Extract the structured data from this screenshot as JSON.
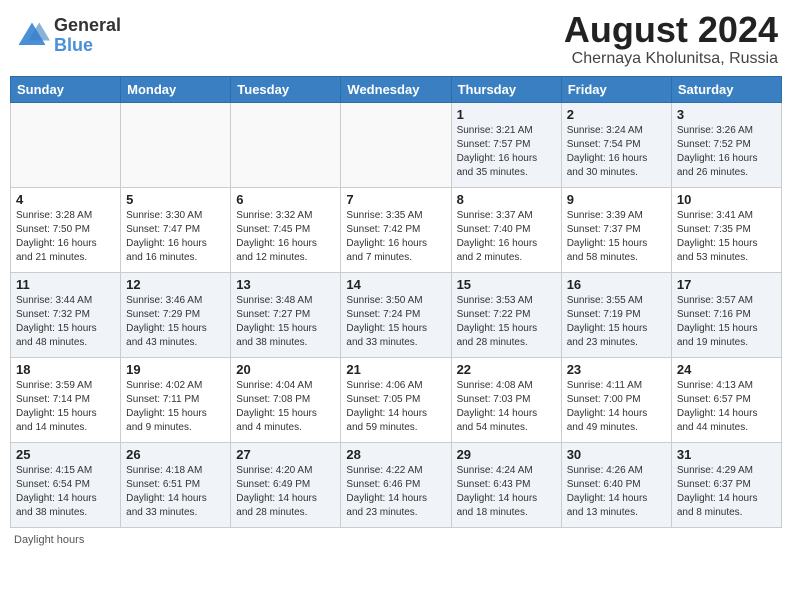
{
  "header": {
    "logo_general": "General",
    "logo_blue": "Blue",
    "month_year": "August 2024",
    "location": "Chernaya Kholunitsa, Russia"
  },
  "days_of_week": [
    "Sunday",
    "Monday",
    "Tuesday",
    "Wednesday",
    "Thursday",
    "Friday",
    "Saturday"
  ],
  "weeks": [
    [
      {
        "day": "",
        "info": ""
      },
      {
        "day": "",
        "info": ""
      },
      {
        "day": "",
        "info": ""
      },
      {
        "day": "",
        "info": ""
      },
      {
        "day": "1",
        "info": "Sunrise: 3:21 AM\nSunset: 7:57 PM\nDaylight: 16 hours and 35 minutes."
      },
      {
        "day": "2",
        "info": "Sunrise: 3:24 AM\nSunset: 7:54 PM\nDaylight: 16 hours and 30 minutes."
      },
      {
        "day": "3",
        "info": "Sunrise: 3:26 AM\nSunset: 7:52 PM\nDaylight: 16 hours and 26 minutes."
      }
    ],
    [
      {
        "day": "4",
        "info": "Sunrise: 3:28 AM\nSunset: 7:50 PM\nDaylight: 16 hours and 21 minutes."
      },
      {
        "day": "5",
        "info": "Sunrise: 3:30 AM\nSunset: 7:47 PM\nDaylight: 16 hours and 16 minutes."
      },
      {
        "day": "6",
        "info": "Sunrise: 3:32 AM\nSunset: 7:45 PM\nDaylight: 16 hours and 12 minutes."
      },
      {
        "day": "7",
        "info": "Sunrise: 3:35 AM\nSunset: 7:42 PM\nDaylight: 16 hours and 7 minutes."
      },
      {
        "day": "8",
        "info": "Sunrise: 3:37 AM\nSunset: 7:40 PM\nDaylight: 16 hours and 2 minutes."
      },
      {
        "day": "9",
        "info": "Sunrise: 3:39 AM\nSunset: 7:37 PM\nDaylight: 15 hours and 58 minutes."
      },
      {
        "day": "10",
        "info": "Sunrise: 3:41 AM\nSunset: 7:35 PM\nDaylight: 15 hours and 53 minutes."
      }
    ],
    [
      {
        "day": "11",
        "info": "Sunrise: 3:44 AM\nSunset: 7:32 PM\nDaylight: 15 hours and 48 minutes."
      },
      {
        "day": "12",
        "info": "Sunrise: 3:46 AM\nSunset: 7:29 PM\nDaylight: 15 hours and 43 minutes."
      },
      {
        "day": "13",
        "info": "Sunrise: 3:48 AM\nSunset: 7:27 PM\nDaylight: 15 hours and 38 minutes."
      },
      {
        "day": "14",
        "info": "Sunrise: 3:50 AM\nSunset: 7:24 PM\nDaylight: 15 hours and 33 minutes."
      },
      {
        "day": "15",
        "info": "Sunrise: 3:53 AM\nSunset: 7:22 PM\nDaylight: 15 hours and 28 minutes."
      },
      {
        "day": "16",
        "info": "Sunrise: 3:55 AM\nSunset: 7:19 PM\nDaylight: 15 hours and 23 minutes."
      },
      {
        "day": "17",
        "info": "Sunrise: 3:57 AM\nSunset: 7:16 PM\nDaylight: 15 hours and 19 minutes."
      }
    ],
    [
      {
        "day": "18",
        "info": "Sunrise: 3:59 AM\nSunset: 7:14 PM\nDaylight: 15 hours and 14 minutes."
      },
      {
        "day": "19",
        "info": "Sunrise: 4:02 AM\nSunset: 7:11 PM\nDaylight: 15 hours and 9 minutes."
      },
      {
        "day": "20",
        "info": "Sunrise: 4:04 AM\nSunset: 7:08 PM\nDaylight: 15 hours and 4 minutes."
      },
      {
        "day": "21",
        "info": "Sunrise: 4:06 AM\nSunset: 7:05 PM\nDaylight: 14 hours and 59 minutes."
      },
      {
        "day": "22",
        "info": "Sunrise: 4:08 AM\nSunset: 7:03 PM\nDaylight: 14 hours and 54 minutes."
      },
      {
        "day": "23",
        "info": "Sunrise: 4:11 AM\nSunset: 7:00 PM\nDaylight: 14 hours and 49 minutes."
      },
      {
        "day": "24",
        "info": "Sunrise: 4:13 AM\nSunset: 6:57 PM\nDaylight: 14 hours and 44 minutes."
      }
    ],
    [
      {
        "day": "25",
        "info": "Sunrise: 4:15 AM\nSunset: 6:54 PM\nDaylight: 14 hours and 38 minutes."
      },
      {
        "day": "26",
        "info": "Sunrise: 4:18 AM\nSunset: 6:51 PM\nDaylight: 14 hours and 33 minutes."
      },
      {
        "day": "27",
        "info": "Sunrise: 4:20 AM\nSunset: 6:49 PM\nDaylight: 14 hours and 28 minutes."
      },
      {
        "day": "28",
        "info": "Sunrise: 4:22 AM\nSunset: 6:46 PM\nDaylight: 14 hours and 23 minutes."
      },
      {
        "day": "29",
        "info": "Sunrise: 4:24 AM\nSunset: 6:43 PM\nDaylight: 14 hours and 18 minutes."
      },
      {
        "day": "30",
        "info": "Sunrise: 4:26 AM\nSunset: 6:40 PM\nDaylight: 14 hours and 13 minutes."
      },
      {
        "day": "31",
        "info": "Sunrise: 4:29 AM\nSunset: 6:37 PM\nDaylight: 14 hours and 8 minutes."
      }
    ]
  ],
  "footer": {
    "note": "Daylight hours"
  }
}
